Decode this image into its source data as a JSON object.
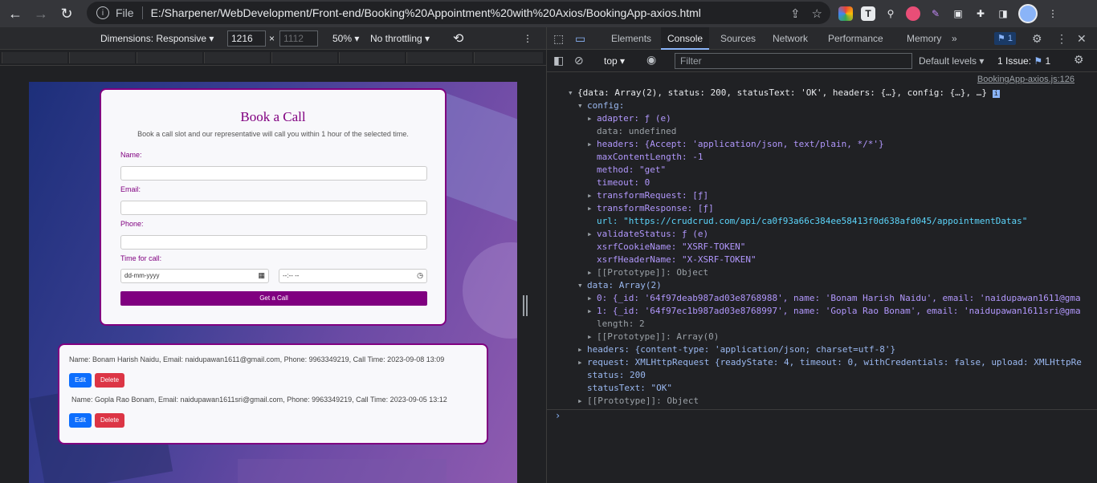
{
  "browser": {
    "url_prefix": "File",
    "url": "E:/Sharpener/WebDevelopment/Front-end/Booking%20Appointment%20with%20Axios/BookingApp-axios.html"
  },
  "device_toolbar": {
    "dimensions_label": "Dimensions: Responsive",
    "width_value": "1216",
    "height_value": "1112",
    "times": "×",
    "zoom": "50%",
    "throttling": "No throttling"
  },
  "form": {
    "title": "Book a Call",
    "subtitle": "Book a call slot and our representative will call you within 1 hour of the selected time.",
    "name_label": "Name:",
    "email_label": "Email:",
    "phone_label": "Phone:",
    "time_label": "Time for call:",
    "date_placeholder": "dd-mm-yyyy",
    "time_placeholder": "--:-- --",
    "submit_label": "Get a Call"
  },
  "appointments": [
    {
      "text": "Name: Bonam Harish Naidu, Email: naidupawan1611@gmail.com, Phone: 9963349219, Call Time: 2023-09-08 13:09",
      "edit": "Edit",
      "delete": "Delete"
    },
    {
      "text": "Name: Gopla Rao Bonam, Email: naidupawan1611sri@gmail.com, Phone: 9963349219, Call Time: 2023-09-05 13:12",
      "edit": "Edit",
      "delete": "Delete"
    }
  ],
  "devtools": {
    "tabs": [
      "Elements",
      "Console",
      "Sources",
      "Network",
      "Performance",
      "Memory"
    ],
    "active_tab": "Console",
    "more_tabs": "»",
    "issues_badge": "1",
    "context": "top",
    "filter_placeholder": "Filter",
    "levels": "Default levels",
    "issues_label": "1 Issue:",
    "issues_count": "1",
    "source_link": "BookingApp-axios.js:126"
  },
  "console_lines": [
    "{data: Array(2), status: 200, statusText: 'OK', headers: {…}, config: {…}, …}",
    "config:",
    "adapter: ƒ (e)",
    "data: undefined",
    "headers: {Accept: 'application/json, text/plain, */*'}",
    "maxContentLength: -1",
    "method: \"get\"",
    "timeout: 0",
    "transformRequest: [ƒ]",
    "transformResponse: [ƒ]",
    "url: \"https://crudcrud.com/api/ca0f93a66c384ee58413f0d638afd045/appointmentDatas\"",
    "validateStatus: ƒ (e)",
    "xsrfCookieName: \"XSRF-TOKEN\"",
    "xsrfHeaderName: \"X-XSRF-TOKEN\"",
    "[[Prototype]]: Object",
    "data: Array(2)",
    "0: {_id: '64f97deab987ad03e8768988', name: 'Bonam Harish Naidu', email: 'naidupawan1611@gma",
    "1: {_id: '64f97ec1b987ad03e8768997', name: 'Gopla Rao Bonam', email: 'naidupawan1611sri@gma",
    "length: 2",
    "[[Prototype]]: Array(0)",
    "headers: {content-type: 'application/json; charset=utf-8'}",
    "request: XMLHttpRequest {readyState: 4, timeout: 0, withCredentials: false, upload: XMLHttpRe",
    "status: 200",
    "statusText: \"OK\"",
    "[[Prototype]]: Object"
  ]
}
